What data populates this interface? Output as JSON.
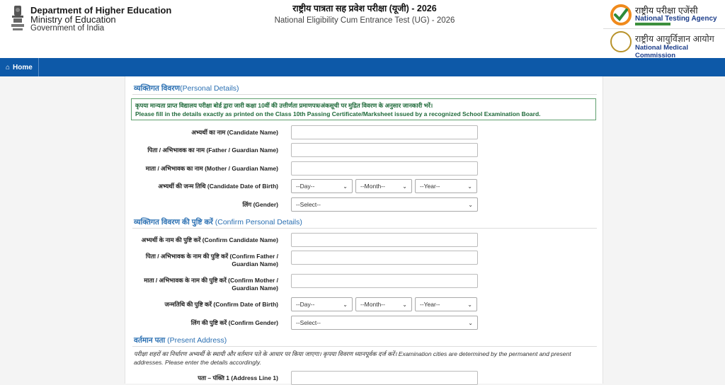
{
  "header": {
    "dept_line1": "Department of Higher Education",
    "dept_line2": "Ministry of Education",
    "dept_line3": "Government of India",
    "title_hindi": "राष्ट्रीय पात्रता सह प्रवेश परीक्षा (यूजी) - 2026",
    "title_english": "National Eligibility Cum Entrance Test (UG) - 2026",
    "nta_hindi": "राष्ट्रीय परीक्षा एजेंसी",
    "nta_english": "National Testing Agency",
    "nmc_hindi": "राष्ट्रीय आयुर्विज्ञान आयोग",
    "nmc_english": "National Medical Commission"
  },
  "nav": {
    "home_label": "Home"
  },
  "personal": {
    "title_hindi": "व्यक्तिगत विवरण",
    "title_english": "(Personal Details)",
    "note_hindi": "कृपया मान्यता प्राप्त विद्यालय परीक्षा बोर्ड द्वारा जारी कक्षा 10वीं की उत्तीर्णता प्रमाणपत्र/अंकसूची पर मुद्रित विवरण के अनुसार जानकारी भरें।",
    "note_english": "Please fill in the details exactly as printed on the Class 10th Passing Certificate/Marksheet issued by a recognized School Examination Board.",
    "candidate_name": "अभ्यर्थी का नाम (Candidate Name)",
    "father_name": "पिता / अभिभावक का नाम (Father / Guardian Name)",
    "mother_name": "माता / अभिभावक का नाम (Mother / Guardian Name)",
    "dob": "अभ्यर्थी की जन्म तिथि (Candidate Date of Birth)",
    "gender": "लिंग (Gender)"
  },
  "confirm": {
    "title_hindi": "व्यक्तिगत विवरण की पुष्टि करें",
    "title_english": "(Confirm Personal Details)",
    "candidate_name": "अभ्यर्थी के नाम की पुष्टि करें (Confirm Candidate Name)",
    "father_name_1": "पिता / अभिभावक के नाम की पुष्टि करें (Confirm Father /",
    "father_name_2": "Guardian Name)",
    "mother_name_1": "माता / अभिभावक के नाम की पुष्टि करें (Confirm Mother /",
    "mother_name_2": "Guardian Name)",
    "dob": "जन्मतिथि की पुष्टि करें (Confirm Date of Birth)",
    "gender": "लिंग की पुष्टि करें (Confirm Gender)"
  },
  "address": {
    "title_hindi": "वर्तमान पता",
    "title_english": "(Present Address)",
    "note": "परीक्षा शहरों का निर्धारण अभ्यर्थी के स्थायी और वर्तमान पते के आधार पर किया जाएगा। कृपया विवरण ध्यानपूर्वक दर्ज करें। Examination cities are determined by the permanent and present addresses. Please enter the details accordingly.",
    "line1": "पता – पंक्ति 1 (Address Line 1)"
  },
  "selects": {
    "day": "--Day--",
    "month": "--Month--",
    "year": "--Year--",
    "gender": "--Select--"
  },
  "colors": {
    "nav_bg": "#0d59a8",
    "section_title": "#2a6fb2",
    "note_border": "#5fa06f",
    "note_text": "#1f6a3a"
  }
}
